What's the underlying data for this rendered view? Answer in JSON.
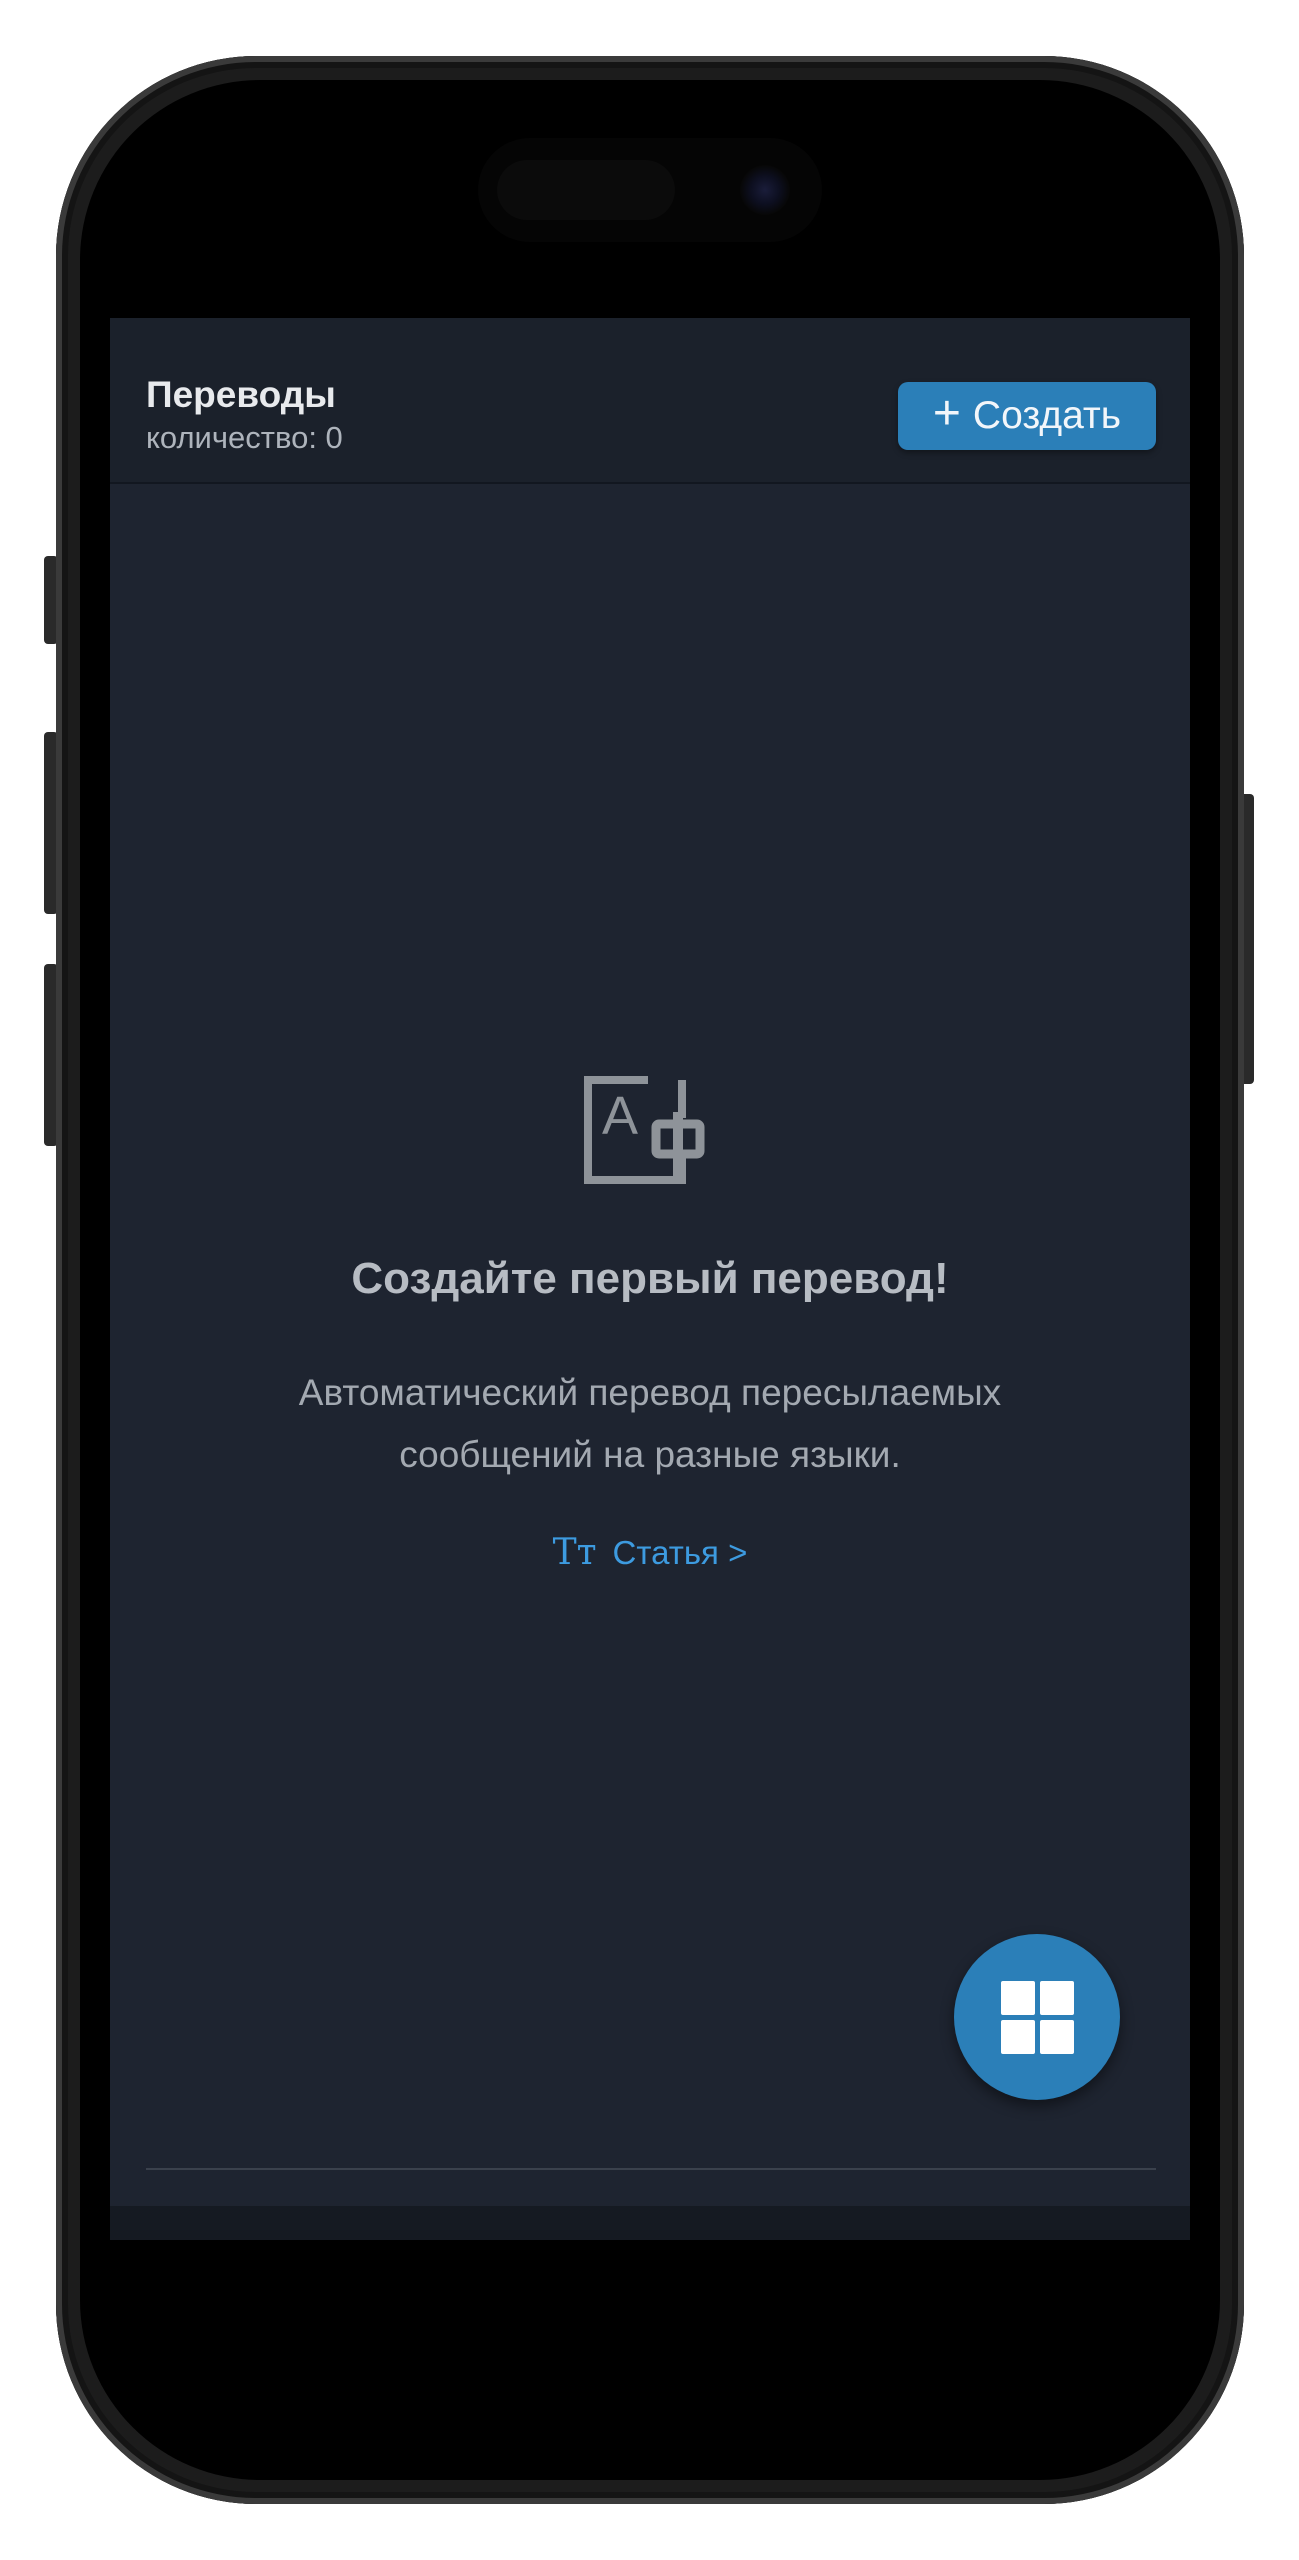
{
  "header": {
    "title": "Переводы",
    "count_label": "количество: 0",
    "create_button": {
      "icon": "plus-icon",
      "label": "Создать"
    }
  },
  "empty_state": {
    "icon": "translate-icon",
    "title": "Создайте первый перевод!",
    "description": "Автоматический перевод пересылаемых сообщений на разные языки.",
    "article_link": {
      "icon": "text-size-icon",
      "icon_glyph": "Tт",
      "label": "Статья >"
    }
  },
  "fab": {
    "icon": "grid-menu-icon"
  },
  "colors": {
    "background": "#1e2430",
    "header": "#1b212b",
    "accent": "#2b7fb8",
    "link": "#3d9be0"
  }
}
